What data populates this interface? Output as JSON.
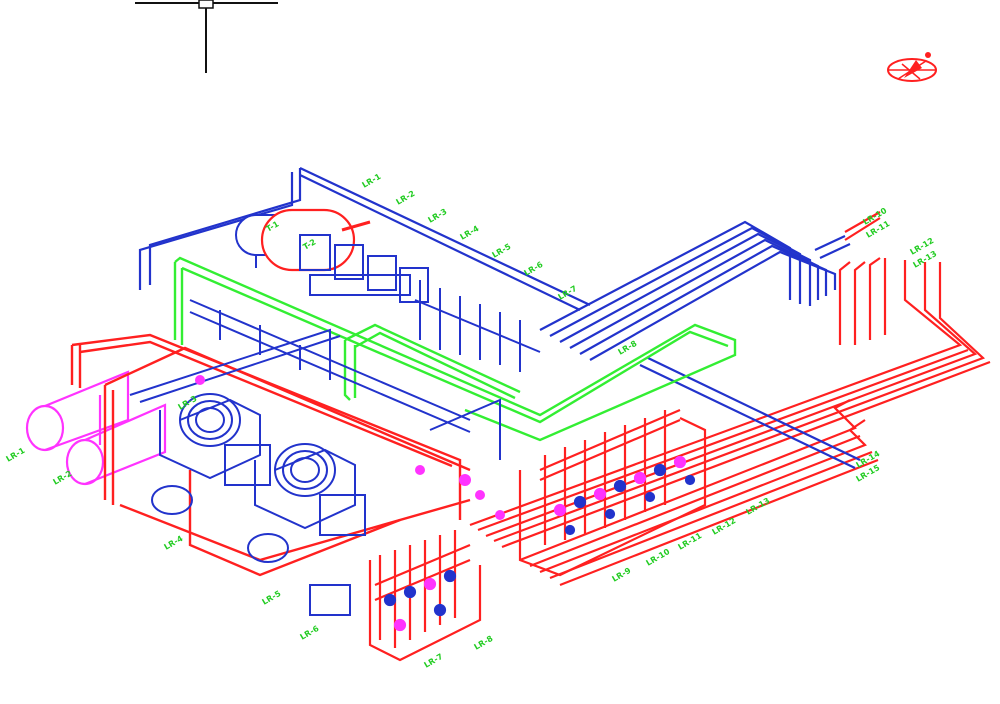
{
  "title": "",
  "colors": {
    "supply": "#ff2020",
    "return": "#2233cc",
    "green": "#33ee33",
    "magenta": "#ff33ff",
    "label": "#22cc22",
    "black": "#111111"
  },
  "labels": {
    "top_1": "LR-1",
    "top_2": "LR-2",
    "top_3": "LR-3",
    "top_4": "LR-4",
    "top_5": "LR-5",
    "top_6": "LR-6",
    "top_7": "LR-7",
    "top_8": "LR-8",
    "tank_1": "T-1",
    "tank_2": "T-2",
    "right_1": "LR-10",
    "right_2": "LR-11",
    "right_3": "LR-12",
    "right_4": "LR-13",
    "right_5": "LR-14",
    "right_6": "LR-15",
    "left_1": "LR-1",
    "left_2": "LR-2",
    "chiller_1": "LR-3",
    "chiller_2": "LR-4",
    "pump_1": "LR-5",
    "bottom_1": "LR-6",
    "bottom_2": "LR-7",
    "bottom_3": "LR-8",
    "bottom_4": "LR-9",
    "bottom_5": "LR-10",
    "bottom_6": "LR-11",
    "bottom_7": "LR-12",
    "bottom_8": "LR-13"
  },
  "icons": {
    "compass": "north-arrow-icon",
    "legend": "pipe-symbol-icon"
  }
}
